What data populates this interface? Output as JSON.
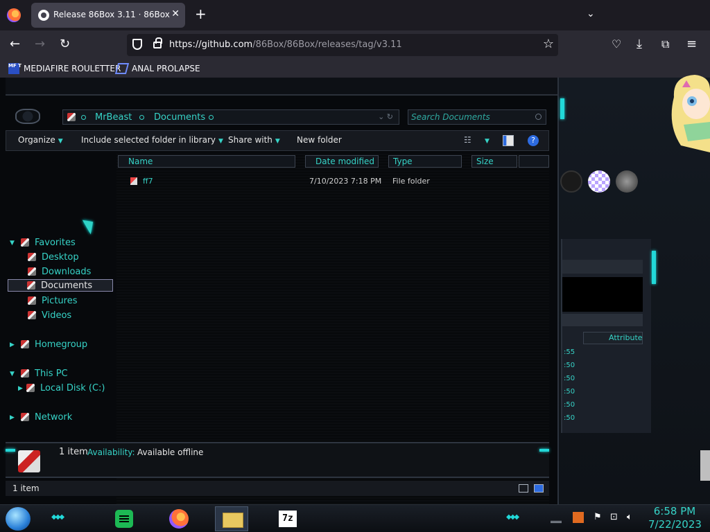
{
  "browser": {
    "tab_title": "Release 86Box 3.11 · 86Box/86Box",
    "tab_close": "✕",
    "new_tab": "+",
    "tab_list": "⌄",
    "url_host": "https://github.com",
    "url_path": "/86Box/86Box/releases/tag/v3.11",
    "bookmarks": [
      {
        "label": "MEDIAFIRE ROULETTER",
        "icon": "mft-icon",
        "icon_text": "MF T"
      },
      {
        "label": "ANAL PROLAPSE",
        "icon": "sigma-icon"
      }
    ]
  },
  "explorer": {
    "breadcrumb": [
      "MrBeast",
      "Documents"
    ],
    "search_placeholder": "Search Documents",
    "toolbar": {
      "organize": "Organize",
      "include": "Include selected folder in library",
      "share": "Share with",
      "new_folder": "New folder"
    },
    "nav": {
      "favorites": "Favorites",
      "favorite_items": [
        "Desktop",
        "Downloads",
        "Documents",
        "Pictures",
        "Videos"
      ],
      "selected": "Documents",
      "homegroup": "Homegroup",
      "this_pc": "This PC",
      "local_disk": "Local Disk (C:)",
      "network": "Network"
    },
    "columns": [
      "Name",
      "Date modified",
      "Type",
      "Size"
    ],
    "files": [
      {
        "name": "ff7",
        "date": "7/10/2023 7:18 PM",
        "type": "File folder",
        "size": ""
      }
    ],
    "details": {
      "count": "1 item",
      "availability_label": "Availability:",
      "availability_value": "Available offline"
    },
    "status": "1 item"
  },
  "background_window": {
    "attributes_header": "Attributes",
    "times": [
      ":55",
      ":50",
      ":50",
      ":50",
      ":50",
      ":50"
    ]
  },
  "taskbar": {
    "sevenzip": "7z",
    "time": "6:58 PM",
    "date": "7/22/2023"
  },
  "colors": {
    "accent": "#36d3c7",
    "glow": "#22d8d8",
    "window_bg": "#07090c"
  }
}
